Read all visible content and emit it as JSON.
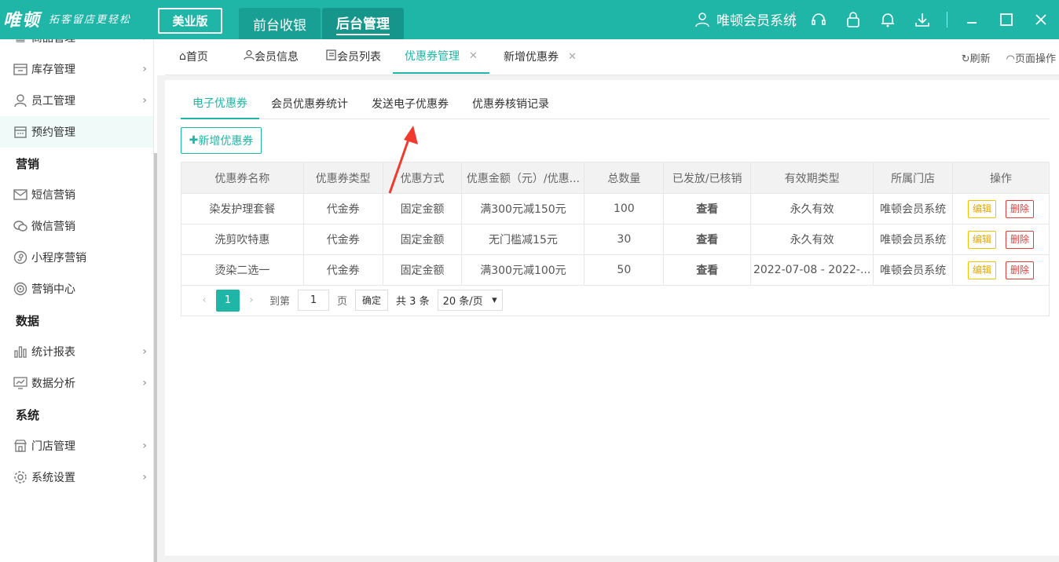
{
  "app": {
    "logo": "唯顿",
    "slogan": "拓客留店更轻松",
    "edition": "美业版",
    "nav": [
      "前台收银",
      "后台管理"
    ],
    "system_name": "唯顿会员系统"
  },
  "sidebar": {
    "items": [
      {
        "label": "商品管理",
        "icon": "grid-icon",
        "arrow": true
      },
      {
        "label": "库存管理",
        "icon": "warehouse-icon",
        "arrow": true
      },
      {
        "label": "员工管理",
        "icon": "person-icon",
        "arrow": true
      },
      {
        "label": "预约管理",
        "icon": "calendar-icon",
        "arrow": false
      },
      {
        "group": "营销"
      },
      {
        "label": "短信营销",
        "icon": "mail-icon",
        "arrow": false
      },
      {
        "label": "微信营销",
        "icon": "wechat-icon",
        "arrow": false
      },
      {
        "label": "小程序营销",
        "icon": "miniapp-icon",
        "arrow": false
      },
      {
        "label": "营销中心",
        "icon": "target-icon",
        "arrow": false
      },
      {
        "group": "数据"
      },
      {
        "label": "统计报表",
        "icon": "bar-chart-icon",
        "arrow": true
      },
      {
        "label": "数据分析",
        "icon": "monitor-chart-icon",
        "arrow": true
      },
      {
        "group": "系统"
      },
      {
        "label": "门店管理",
        "icon": "store-icon",
        "arrow": true
      },
      {
        "label": "系统设置",
        "icon": "gear-icon",
        "arrow": true
      }
    ]
  },
  "tabs": {
    "items": [
      {
        "label": "首页",
        "icon": "home-icon"
      },
      {
        "label": "会员信息",
        "icon": "person-icon"
      },
      {
        "label": "会员列表",
        "icon": "list-icon"
      },
      {
        "label": "优惠券管理",
        "closable": true,
        "active": true
      },
      {
        "label": "新增优惠券",
        "closable": true
      }
    ],
    "refresh": "刷新",
    "page_ops": "页面操作"
  },
  "subtabs": [
    "电子优惠券",
    "会员优惠券统计",
    "发送电子优惠券",
    "优惠券核销记录"
  ],
  "add_button": "新增优惠券",
  "table": {
    "headers": [
      "优惠券名称",
      "优惠券类型",
      "优惠方式",
      "优惠金额（元）/优惠...",
      "总数量",
      "已发放/已核销",
      "有效期类型",
      "所属门店",
      "操作"
    ],
    "rows": [
      {
        "name": "染发护理套餐",
        "type": "代金券",
        "method": "固定金额",
        "amount": "满300元减150元",
        "total": "100",
        "issued": "查看",
        "validity": "永久有效",
        "store": "唯顿会员系统",
        "edit": "编辑",
        "del": "删除"
      },
      {
        "name": "洗剪吹特惠",
        "type": "代金券",
        "method": "固定金额",
        "amount": "无门槛减15元",
        "total": "30",
        "issued": "查看",
        "validity": "永久有效",
        "store": "唯顿会员系统",
        "edit": "编辑",
        "del": "删除"
      },
      {
        "name": "烫染二选一",
        "type": "代金券",
        "method": "固定金额",
        "amount": "满300元减100元",
        "total": "50",
        "issued": "查看",
        "validity": "2022-07-08 - 2022-...",
        "store": "唯顿会员系统",
        "edit": "编辑",
        "del": "删除"
      }
    ]
  },
  "pager": {
    "current": "1",
    "goto_label": "到第",
    "goto_value": "1",
    "page_unit": "页",
    "confirm": "确定",
    "total": "共 3 条",
    "page_size": "20 条/页"
  },
  "colors": {
    "brand": "#1fb5a7",
    "link": "#1a6db5",
    "edit": "#e6a700",
    "delete": "#e23c3c",
    "annotation_arrow": "#f03a2e"
  }
}
